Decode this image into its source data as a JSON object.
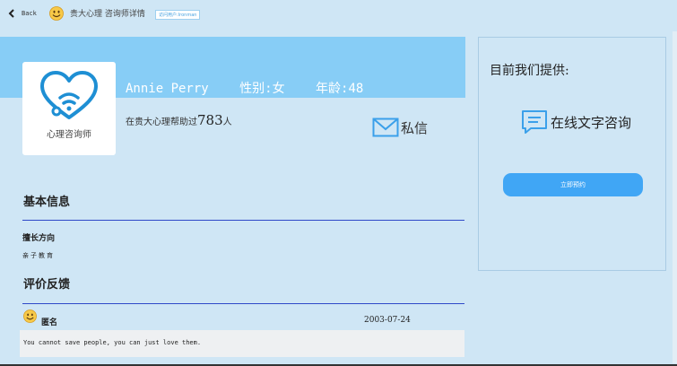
{
  "header": {
    "back_label": "Back",
    "app_title": "贵大心理 咨询师详情",
    "visitor_badge": "访问用户:Ironman"
  },
  "profile": {
    "avatar_caption": "心理咨询师",
    "name": "Annie Perry",
    "gender": "性别:女",
    "age": "年龄:48",
    "helped_prefix": "在贵大心理帮助过",
    "helped_count": "783",
    "helped_suffix": "人",
    "message_label": "私信"
  },
  "basic_info": {
    "title": "基本信息",
    "specialty_label": "擅长方向",
    "specialty_value": "亲子教育"
  },
  "reviews": {
    "title": "评价反馈",
    "items": [
      {
        "user": "匿名",
        "date": "2003-07-24",
        "text": "You cannot save people, you can just love them."
      }
    ]
  },
  "services": {
    "title": "目前我们提供:",
    "item_label": "在线文字咨询",
    "book_button": "立即预约"
  },
  "colors": {
    "banner": "#87cdf6",
    "accent": "#40a6f5",
    "divider": "#2f49c8",
    "background": "#cfe6f5"
  }
}
